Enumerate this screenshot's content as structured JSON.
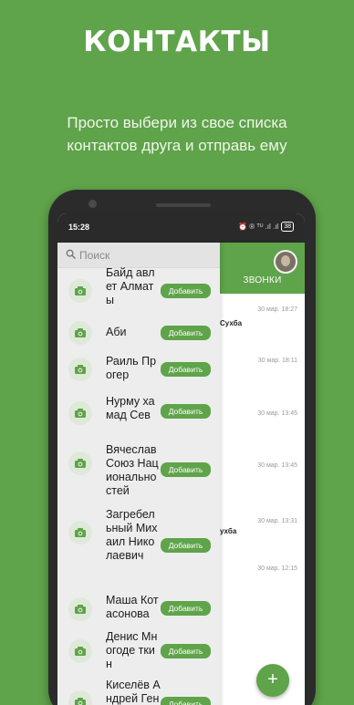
{
  "header": {
    "title": "КОНТАКТЫ",
    "subtitle_line1": "Просто выбери из свое списка",
    "subtitle_line2": "контактов друга и отправь ему"
  },
  "status_bar": {
    "time": "15:28",
    "icons": "⏰ ® ᵀᵁ .ıl .ıl",
    "battery": "38"
  },
  "search": {
    "placeholder": "Поиск"
  },
  "contacts": [
    {
      "name": "Байд авлет Алматы",
      "button": "Добавить"
    },
    {
      "name": "Аби",
      "button": "Добавить"
    },
    {
      "name": "Раиль Прогер",
      "button": "Добавить"
    },
    {
      "name": "Нурму хамад Сев",
      "button": "Добавить"
    },
    {
      "name": "Вячеслав Союз Национальностей",
      "button": "Добавить"
    },
    {
      "name": "Загребельный Михаил Николаевич",
      "button": "Добавить"
    },
    {
      "name": "Маша Котасонова",
      "button": "Добавить"
    },
    {
      "name": "Денис Многоде ткин",
      "button": "Добавить"
    },
    {
      "name": "Киселёв Андрей Геннадьевич",
      "button": "Добавить"
    }
  ],
  "calls": {
    "tab_label": "ЗВОНКИ",
    "times": [
      "30 мар. 18:27",
      "30 мар. 18:11",
      "30 мар. 13:45",
      "30 мар. 13:45",
      "30 мар. 13:31",
      "30 мар. 12:15"
    ],
    "peek_names": [
      "Сухба",
      "ухба"
    ]
  },
  "fab": {
    "label": "+"
  },
  "colors": {
    "accent": "#5fa34a",
    "background": "#5fa34a"
  }
}
